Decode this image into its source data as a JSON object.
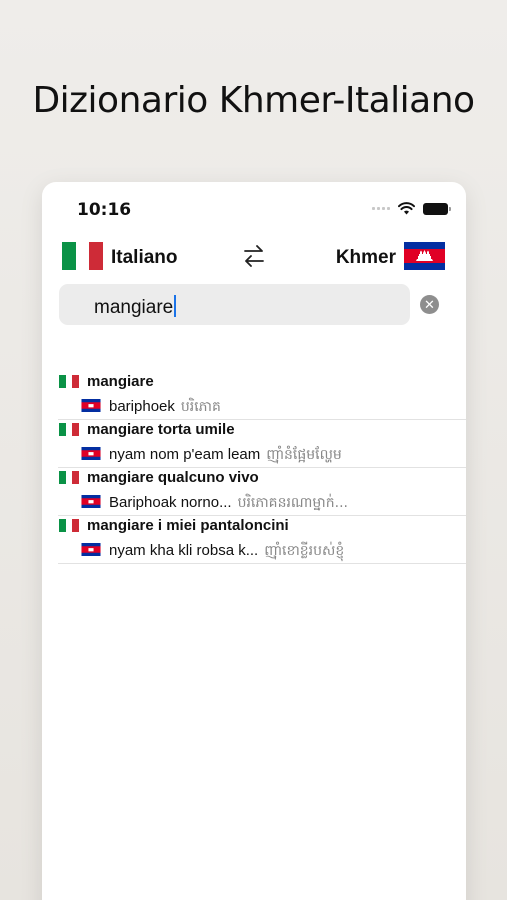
{
  "headline": "Dizionario Khmer-Italiano",
  "status": {
    "time": "10:16"
  },
  "languages": {
    "left": "Italiano",
    "right": "Khmer"
  },
  "search": {
    "value": "mangiare",
    "clear_label": "✕"
  },
  "results": [
    {
      "title": "mangiare",
      "translit": "bariphoek",
      "khmer": "បរិភោគ"
    },
    {
      "title": "mangiare torta umile",
      "translit": "nyam nom p'eam leam",
      "khmer": "ញ៉ាំនំផ្អែមល្ហែម"
    },
    {
      "title": "mangiare qualcuno vivo",
      "translit": "Bariphoak norno...",
      "khmer": "បរិភោគនរណាម្នាក់..."
    },
    {
      "title": "mangiare i miei pantaloncini",
      "translit": "nyam kha kli robsa k...",
      "khmer": "ញ៉ាំខោខ្លីរបស់ខ្ញុំ"
    }
  ],
  "colors": {
    "it_green": "#0a9246",
    "it_white": "#ffffff",
    "it_red": "#ce2b37",
    "kh_blue": "#032ea1",
    "kh_red": "#e00025"
  },
  "icons": [
    "wifi-icon",
    "battery-icon",
    "swap-arrows-icon",
    "clear-search-icon",
    "italy-flag-icon",
    "cambodia-flag-icon"
  ]
}
